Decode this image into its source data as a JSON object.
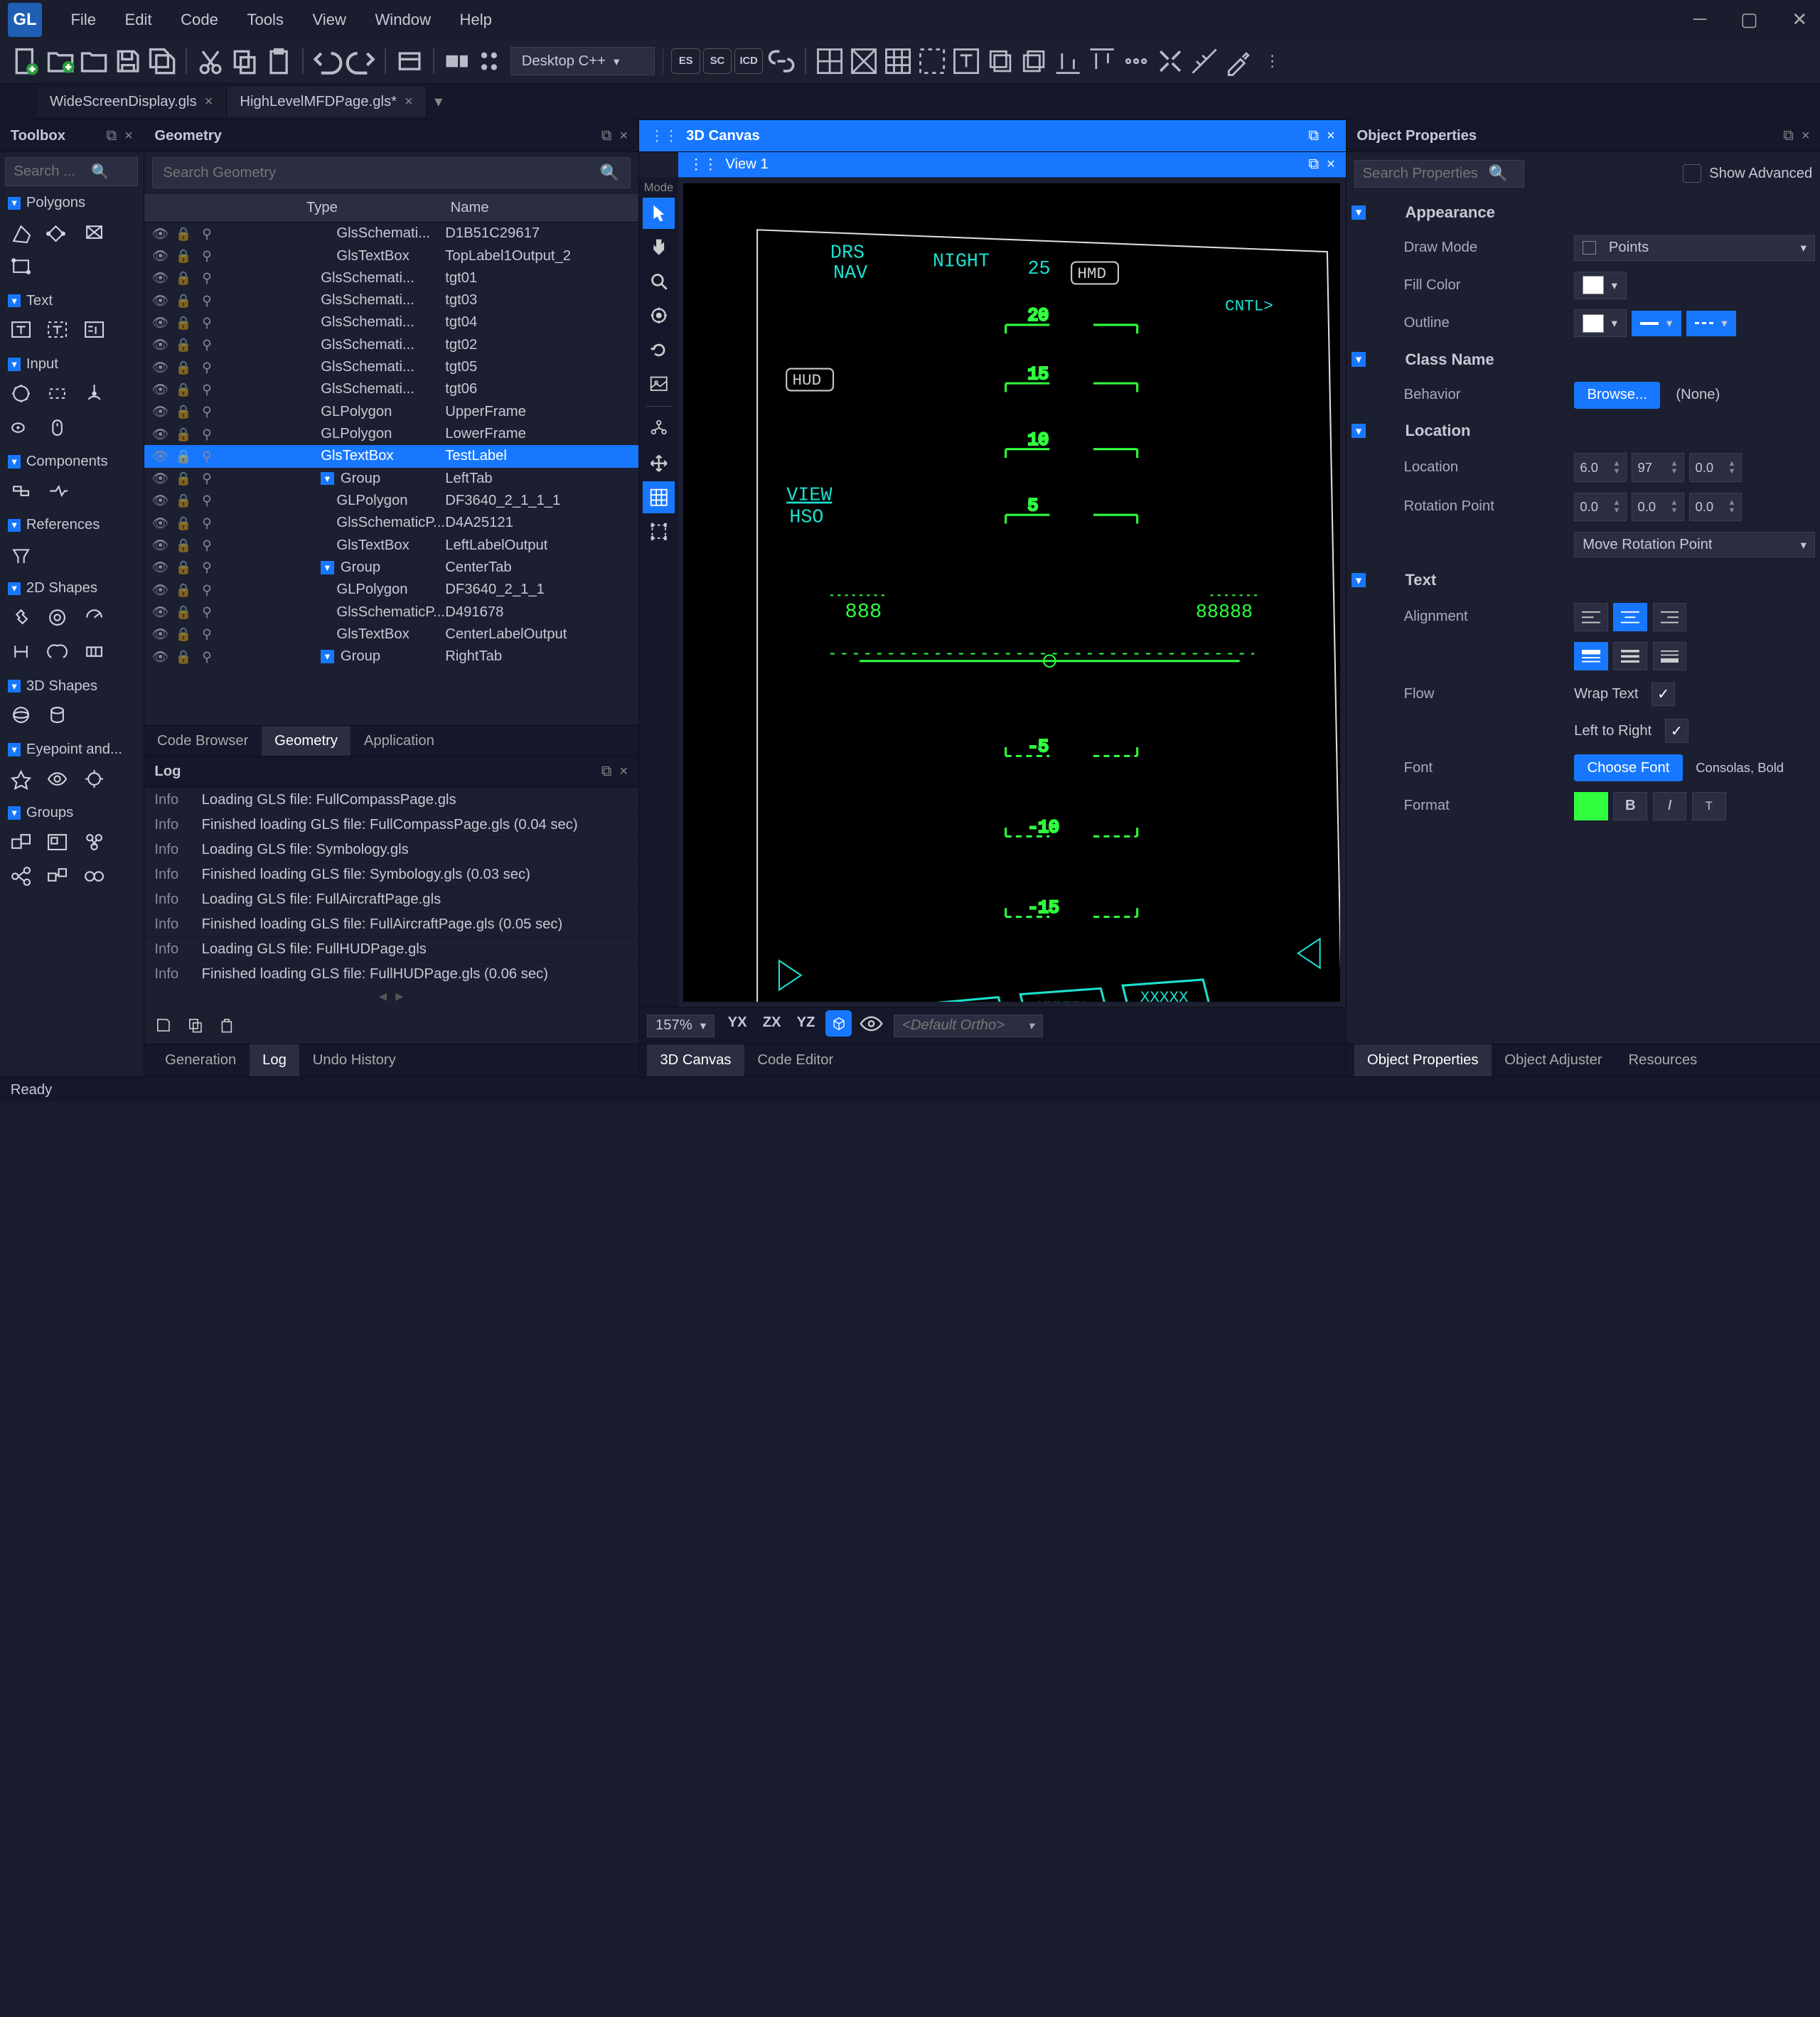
{
  "app": {
    "logo": "GL"
  },
  "menu": [
    "File",
    "Edit",
    "Code",
    "Tools",
    "View",
    "Window",
    "Help"
  ],
  "toolbar": {
    "target": "Desktop C++",
    "badges": [
      "ES",
      "SC",
      "ICD"
    ]
  },
  "open_tabs": [
    {
      "name": "WideScreenDisplay.gls",
      "dirty": false,
      "active": false
    },
    {
      "name": "HighLevelMFDPage.gls*",
      "dirty": true,
      "active": true
    }
  ],
  "toolbox": {
    "title": "Toolbox",
    "search_placeholder": "Search ...",
    "sections": [
      "Polygons",
      "Text",
      "Input",
      "Components",
      "References",
      "2D Shapes",
      "3D Shapes",
      "Eyepoint and...",
      "Groups"
    ]
  },
  "geometry": {
    "title": "Geometry",
    "search_placeholder": "Search Geometry",
    "columns": {
      "type": "Type",
      "name": "Name"
    },
    "rows": [
      {
        "depth": 2,
        "type": "GlsSchemati...",
        "name": "D1B51C29617"
      },
      {
        "depth": 2,
        "type": "GlsTextBox",
        "name": "TopLabel1Output_2"
      },
      {
        "depth": 1,
        "type": "GlsSchemati...",
        "name": "tgt01"
      },
      {
        "depth": 1,
        "type": "GlsSchemati...",
        "name": "tgt03"
      },
      {
        "depth": 1,
        "type": "GlsSchemati...",
        "name": "tgt04"
      },
      {
        "depth": 1,
        "type": "GlsSchemati...",
        "name": "tgt02"
      },
      {
        "depth": 1,
        "type": "GlsSchemati...",
        "name": "tgt05"
      },
      {
        "depth": 1,
        "type": "GlsSchemati...",
        "name": "tgt06"
      },
      {
        "depth": 1,
        "type": "GLPolygon",
        "name": "UpperFrame"
      },
      {
        "depth": 1,
        "type": "GLPolygon",
        "name": "LowerFrame"
      },
      {
        "depth": 1,
        "type": "GlsTextBox",
        "name": "TestLabel",
        "selected": true
      },
      {
        "depth": 1,
        "type": "Group",
        "name": "LeftTab",
        "group": true
      },
      {
        "depth": 2,
        "type": "GLPolygon",
        "name": "DF3640_2_1_1_1"
      },
      {
        "depth": 2,
        "type": "GlsSchematicP...",
        "name": "D4A25121"
      },
      {
        "depth": 2,
        "type": "GlsTextBox",
        "name": "LeftLabelOutput"
      },
      {
        "depth": 1,
        "type": "Group",
        "name": "CenterTab",
        "group": true
      },
      {
        "depth": 2,
        "type": "GLPolygon",
        "name": "DF3640_2_1_1"
      },
      {
        "depth": 2,
        "type": "GlsSchematicP...",
        "name": "D491678"
      },
      {
        "depth": 2,
        "type": "GlsTextBox",
        "name": "CenterLabelOutput"
      },
      {
        "depth": 1,
        "type": "Group",
        "name": "RightTab",
        "group": true
      }
    ],
    "tabs": [
      "Code Browser",
      "Geometry",
      "Application"
    ],
    "active_tab": "Geometry"
  },
  "log": {
    "title": "Log",
    "entries": [
      {
        "level": "Info",
        "msg": "Loading GLS file: FullCompassPage.gls"
      },
      {
        "level": "Info",
        "msg": "Finished loading GLS file: FullCompassPage.gls (0.04 sec)"
      },
      {
        "level": "Info",
        "msg": "Loading GLS file: Symbology.gls"
      },
      {
        "level": "Info",
        "msg": "Finished loading GLS file: Symbology.gls (0.03 sec)"
      },
      {
        "level": "Info",
        "msg": "Loading GLS file: FullAircraftPage.gls"
      },
      {
        "level": "Info",
        "msg": "Finished loading GLS file: FullAircraftPage.gls (0.05 sec)"
      },
      {
        "level": "Info",
        "msg": "Loading GLS file: FullHUDPage.gls"
      },
      {
        "level": "Info",
        "msg": "Finished loading GLS file: FullHUDPage.gls (0.06 sec)"
      }
    ],
    "bottom_tabs": [
      "Generation",
      "Log",
      "Undo History"
    ],
    "active_bottom_tab": "Log"
  },
  "canvas": {
    "title": "3D Canvas",
    "mode_label": "Mode",
    "view_title": "View 1",
    "zoom": "157%",
    "axes": [
      "YX",
      "ZX",
      "YZ"
    ],
    "ortho": "<Default Ortho>",
    "bottom_tabs": [
      "3D Canvas",
      "Code Editor"
    ],
    "active_bottom_tab": "3D Canvas",
    "hud": {
      "drs": "DRS",
      "nav": "NAV",
      "night": "NIGHT",
      "tag_25": "25",
      "hmd": "HMD",
      "cntl": "CNTL>",
      "hud": "HUD",
      "scale": [
        "20",
        "15",
        "10",
        "5",
        "-5",
        "-10",
        "-15"
      ],
      "view": "VIEW",
      "hso": "HSO",
      "left_num": "888",
      "right_num": "88888",
      "tabs": [
        "XXXXX",
        "XXXXX",
        "XXXXX"
      ]
    }
  },
  "properties": {
    "title": "Object Properties",
    "search_placeholder": "Search Properties",
    "show_advanced": "Show Advanced",
    "sections": {
      "appearance": {
        "title": "Appearance",
        "draw_mode": {
          "label": "Draw Mode",
          "value": "Points"
        },
        "fill_color": {
          "label": "Fill Color"
        },
        "outline": {
          "label": "Outline"
        }
      },
      "class_name": {
        "title": "Class Name",
        "behavior": {
          "label": "Behavior",
          "button": "Browse...",
          "value": "(None)"
        }
      },
      "location": {
        "title": "Location",
        "location": {
          "label": "Location",
          "x": "6.0",
          "y": "97",
          "z": "0.0"
        },
        "rotation_point": {
          "label": "Rotation Point",
          "x": "0.0",
          "y": "0.0",
          "z": "0.0"
        },
        "move_rotation": "Move Rotation Point"
      },
      "text": {
        "title": "Text",
        "alignment": {
          "label": "Alignment"
        },
        "flow": {
          "label": "Flow",
          "wrap": "Wrap Text",
          "ltr": "Left to Right"
        },
        "font": {
          "label": "Font",
          "button": "Choose Font",
          "value": "Consolas, Bold"
        },
        "format": {
          "label": "Format"
        }
      }
    },
    "bottom_tabs": [
      "Object Properties",
      "Object Adjuster",
      "Resources"
    ],
    "active_bottom_tab": "Object Properties"
  },
  "status": "Ready"
}
